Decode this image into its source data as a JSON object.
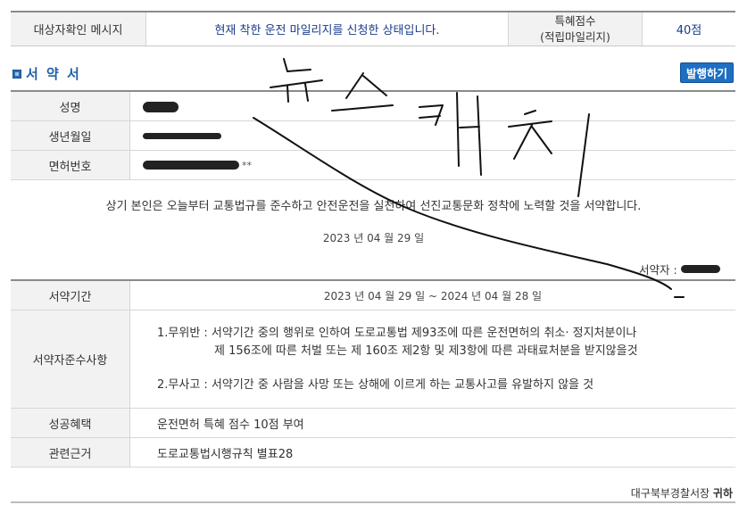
{
  "top_bar": {
    "target_label": "대상자확인 메시지",
    "message": "현재 착한 운전 마일리지를 신청한 상태입니다.",
    "points_label_line1": "특혜점수",
    "points_label_line2": "(적립마일리지)",
    "points_value": "40점"
  },
  "section": {
    "title": "서 약 서",
    "issue_button": "발행하기"
  },
  "info": {
    "name_label": "성명",
    "birth_label": "생년월일",
    "license_label": "면허번호",
    "license_suffix": "**"
  },
  "pledge": {
    "text": "상기 본인은 오늘부터 교통법규를 준수하고 안전운전을 실천하여 선진교통문화 정착에 노력할 것을 서약합니다.",
    "date": "2023 년 04 월 29 일",
    "signer_label": "서약자 :"
  },
  "conditions": {
    "period_label": "서약기간",
    "period_value": "2023 년 04 월 29 일 ~ 2024 년 04 월 28 일",
    "rules_label": "서약자준수사항",
    "rule1_line1": "1.무위반 : 서약기간 중의 행위로 인하여 도로교통법 제93조에 따른 운전면허의 취소· 정지처분이나",
    "rule1_line2": "제 156조에 따른 처벌 또는 제 160조 제2항 및 제3항에 따른 과태료처분을 받지않을것",
    "rule2": "2.무사고 : 서약기간 중 사람을 사망 또는 상해에 이르게 하는 교통사고를 유발하지 않을 것",
    "benefit_label": "성공혜택",
    "benefit_value": "운전면허 특혜 점수 10점 부여",
    "basis_label": "관련근거",
    "basis_value": "도로교통법시행규칙 별표28"
  },
  "footer": {
    "issuer": "대구북부경찰서장",
    "suffix": "귀하"
  },
  "handwriting": {
    "text": "뉴스캐치"
  },
  "colors": {
    "accent_blue": "#1d6fc3",
    "message_blue": "#1a3c8a",
    "label_bg": "#f2f2f2"
  }
}
